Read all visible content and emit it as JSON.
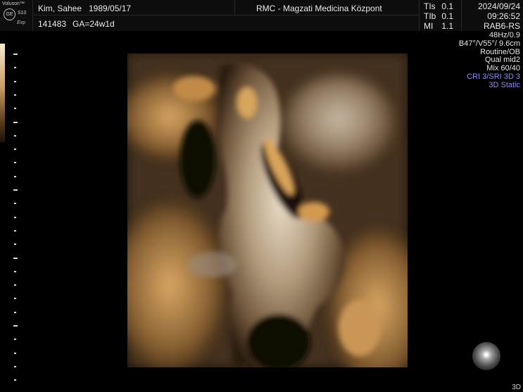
{
  "logo": {
    "brand": "Voluson™",
    "emblem": "GE",
    "model": "S10",
    "edition": "Exp"
  },
  "header": {
    "patient_name": "Kim, Sahee",
    "birth_date": "1989/05/17",
    "patient_id": "141483",
    "gestational_age": "GA=24w1d",
    "institution": "RMC - Magzati Medicina Központ"
  },
  "indices": [
    {
      "label": "TIs",
      "value": "0.1"
    },
    {
      "label": "TIb",
      "value": "0.1"
    },
    {
      "label": "MI",
      "value": "1.1"
    }
  ],
  "datetime": {
    "date": "2024/09/24",
    "time": "09:26:52"
  },
  "probe": "RAB6-RS",
  "params": [
    {
      "text": "48Hz/0.9",
      "color": "#e6e6e6"
    },
    {
      "text": "B47°/V55°/ 9.6cm",
      "color": "#e6e6e6"
    },
    {
      "text": "Routine/OB",
      "color": "#e6e6e6"
    },
    {
      "text": "Qual mid2",
      "color": "#e6e6e6"
    },
    {
      "text": "Mix 60/40",
      "color": "#e6e6e6"
    },
    {
      "text": "CRI 3/SRI 3D 3",
      "color": "#8a8aff"
    },
    {
      "text": "3D Static",
      "color": "#8a8aff"
    }
  ],
  "footer_tag": "3D"
}
